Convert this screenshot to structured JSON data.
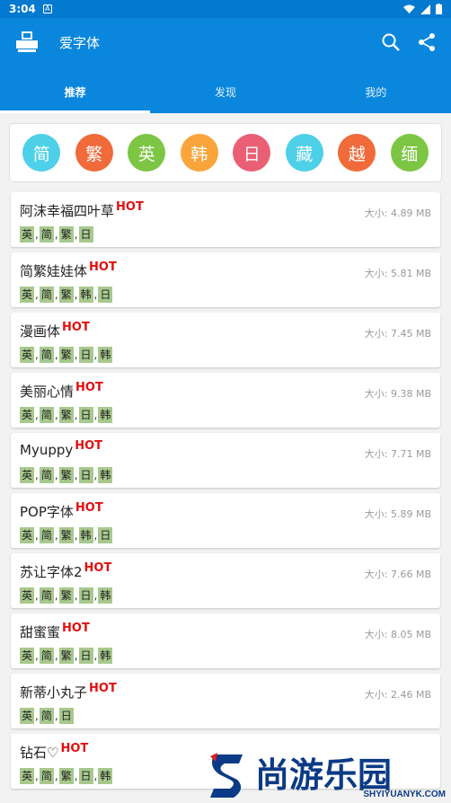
{
  "status_bar": {
    "time": "3:04",
    "notification_icon": "A"
  },
  "app_bar": {
    "title": "爱字体",
    "logo_icon": "app-logo",
    "search_icon": "search-icon",
    "share_icon": "share-icon"
  },
  "tabs": [
    {
      "label": "推荐",
      "active": true
    },
    {
      "label": "发现",
      "active": false
    },
    {
      "label": "我的",
      "active": false
    }
  ],
  "languages": [
    {
      "label": "简",
      "color": "#4dd0e8"
    },
    {
      "label": "繁",
      "color": "#f06a3a"
    },
    {
      "label": "英",
      "color": "#7cc644"
    },
    {
      "label": "韩",
      "color": "#f9a53c"
    },
    {
      "label": "日",
      "color": "#ea5f74"
    },
    {
      "label": "藏",
      "color": "#4dd0e8"
    },
    {
      "label": "越",
      "color": "#f06a3a"
    },
    {
      "label": "缅",
      "color": "#7cc644"
    }
  ],
  "hot_label": "HOT",
  "fonts": [
    {
      "name": "阿沫幸福四叶草",
      "size": "大小: 4.89 MB",
      "tags": [
        "英",
        "简",
        "繁",
        "日"
      ]
    },
    {
      "name": "简繁娃娃体",
      "size": "大小: 5.81 MB",
      "tags": [
        "英",
        "简",
        "繁",
        "韩",
        "日"
      ]
    },
    {
      "name": "漫画体",
      "size": "大小: 7.45 MB",
      "tags": [
        "英",
        "简",
        "繁",
        "日",
        "韩"
      ]
    },
    {
      "name": "美丽心情",
      "size": "大小: 9.38 MB",
      "tags": [
        "英",
        "简",
        "繁",
        "日",
        "韩"
      ]
    },
    {
      "name": "Myuppy",
      "size": "大小: 7.71 MB",
      "tags": [
        "英",
        "简",
        "繁",
        "日",
        "韩"
      ]
    },
    {
      "name": "POP字体",
      "size": "大小: 5.89 MB",
      "tags": [
        "英",
        "简",
        "繁",
        "韩",
        "日"
      ]
    },
    {
      "name": "苏让字体2",
      "size": "大小: 7.66 MB",
      "tags": [
        "英",
        "简",
        "繁",
        "日",
        "韩"
      ]
    },
    {
      "name": "甜蜜蜜",
      "size": "大小: 8.05 MB",
      "tags": [
        "英",
        "简",
        "繁",
        "日",
        "韩"
      ]
    },
    {
      "name": "新蒂小丸子",
      "size": "大小: 2.46 MB",
      "tags": [
        "英",
        "简",
        "日"
      ]
    },
    {
      "name": "钻石♡",
      "size": "",
      "tags": [
        "英",
        "简",
        "繁",
        "日",
        "韩"
      ]
    }
  ],
  "watermark": {
    "text": "尚游乐园",
    "url": "SHYIYUANYK.COM"
  }
}
